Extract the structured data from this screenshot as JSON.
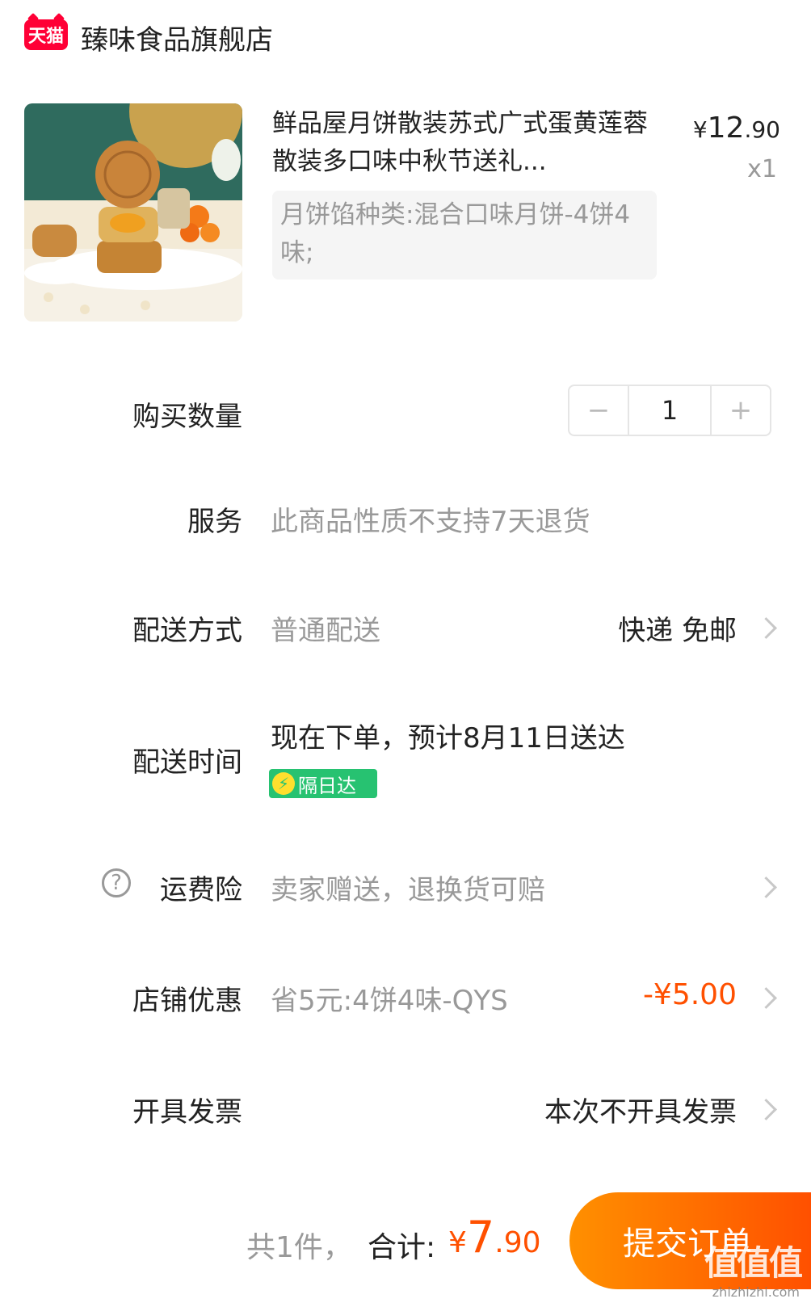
{
  "header": {
    "logo_text": "天猫",
    "store_name": "臻味食品旗舰店"
  },
  "product": {
    "title": "鲜品屋月饼散装苏式广式蛋黄莲蓉散装多口味中秋节送礼...",
    "price_currency": "¥",
    "price_int": "12",
    "price_dec": ".90",
    "quantity": "x1",
    "sku": "月饼馅种类:混合口味月饼-4饼4味;"
  },
  "quantity_row": {
    "label": "购买数量",
    "minus": "−",
    "value": "1",
    "plus": "+"
  },
  "service_row": {
    "label": "服务",
    "value": "此商品性质不支持7天退货"
  },
  "shipping_row": {
    "label": "配送方式",
    "value": "普通配送",
    "right": "快递 免邮"
  },
  "delivery_time_row": {
    "label": "配送时间",
    "value": "现在下单，预计8月11日送达",
    "badge": "隔日达"
  },
  "insurance_row": {
    "icon": "?",
    "label": "运费险",
    "value": "卖家赠送，退换货可赔"
  },
  "discount_row": {
    "label": "店铺优惠",
    "value": "省5元:4饼4味-QYS",
    "amount": "-¥5.00",
    "amount_color": "#ff5000"
  },
  "invoice_row": {
    "label": "开具发票",
    "value": "本次不开具发票"
  },
  "bottom_bar": {
    "count_text": "共1件，",
    "total_label": "合计:",
    "currency": "¥",
    "total_int": "7",
    "total_dec": ".90",
    "submit_label": "提交订单",
    "accent": "#ff5000"
  },
  "watermark": {
    "main": "值值值",
    "sub": "zhizhizhi.com"
  }
}
